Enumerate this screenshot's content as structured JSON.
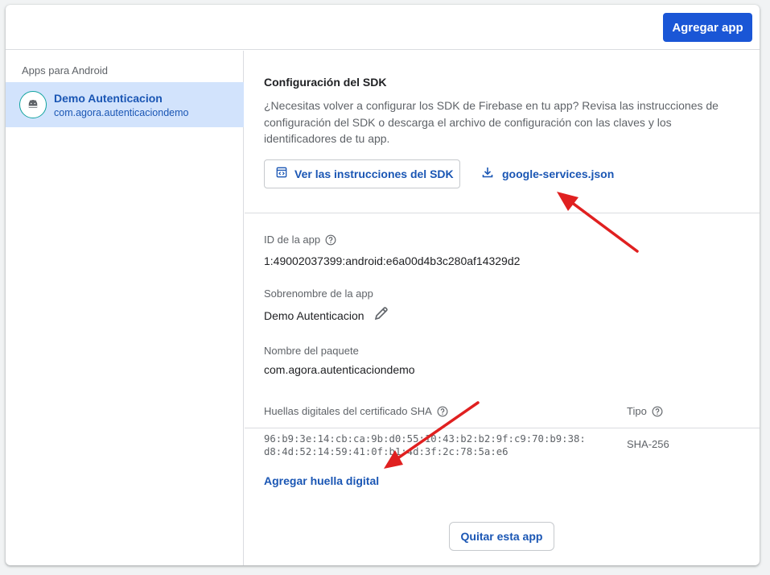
{
  "header": {
    "add_app_label": "Agregar app"
  },
  "sidebar": {
    "heading": "Apps para Android",
    "app": {
      "name": "Demo Autenticacion",
      "package": "com.agora.autenticaciondemo",
      "icon": "android-icon"
    }
  },
  "sdk": {
    "title": "Configuración del SDK",
    "description": "¿Necesitas volver a configurar los SDK de Firebase en tu app? Revisa las instrucciones de configuración del SDK o descarga el archivo de configuración con las claves y los identificadores de tu app.",
    "instructions_button": "Ver las instrucciones del SDK",
    "download_link": "google-services.json"
  },
  "fields": {
    "app_id_label": "ID de la app",
    "app_id_value": "1:49002037399:android:e6a00d4b3c280af14329d2",
    "nickname_label": "Sobrenombre de la app",
    "nickname_value": "Demo Autenticacion",
    "package_label": "Nombre del paquete",
    "package_value": "com.agora.autenticaciondemo"
  },
  "sha": {
    "header": "Huellas digitales del certificado SHA",
    "type_header": "Tipo",
    "fingerprint_line1": "96:b9:3e:14:cb:ca:9b:d0:55:10:43:b2:b2:9f:c9:70:b9:38:",
    "fingerprint_line2": "d8:4d:52:14:59:41:0f:b1:4d:3f:2c:78:5a:e6",
    "type": "SHA-256",
    "add_fingerprint": "Agregar huella digital"
  },
  "footer": {
    "remove_app_label": "Quitar esta app"
  },
  "colors": {
    "primary": "#1a56d6",
    "link": "#1a56b4",
    "selected_bg": "#d2e3fc",
    "annotation_arrow": "#e02020"
  }
}
